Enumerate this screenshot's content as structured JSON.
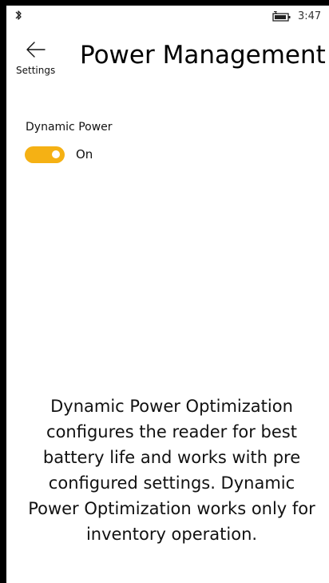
{
  "status_bar": {
    "bluetooth_icon": "bluetooth-icon",
    "battery_icon": "battery-charging-icon",
    "time": "3:47"
  },
  "header": {
    "back_icon": "back-arrow-icon",
    "back_label": "Settings",
    "title": "Power Management"
  },
  "dynamic_power": {
    "label": "Dynamic Power",
    "toggle_on": true,
    "state_label": "On"
  },
  "description": "Dynamic Power Optimization configures the reader for best battery life  and works with pre configured  settings. Dynamic Power Optimization works only for inventory operation.",
  "colors": {
    "accent": "#F5B114",
    "background": "#FFFFFF",
    "text": "#111111"
  }
}
